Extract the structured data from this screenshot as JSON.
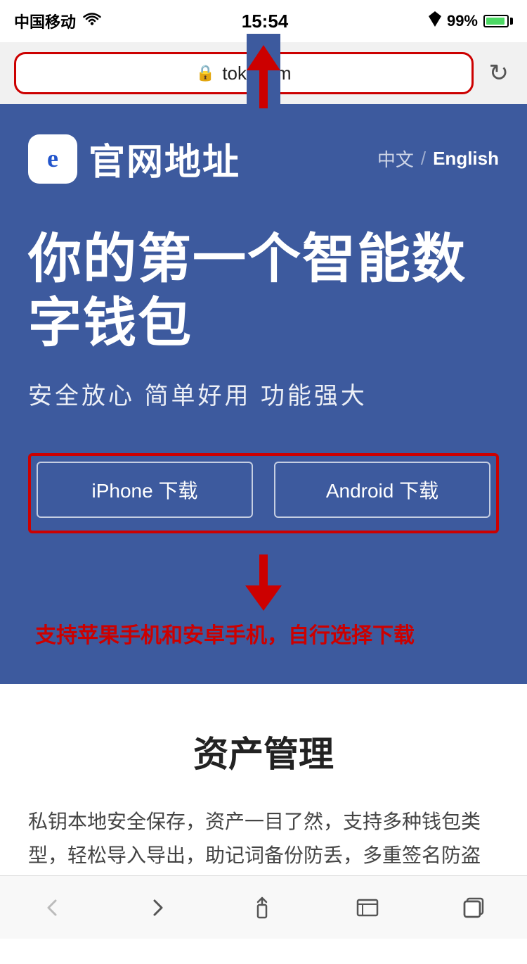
{
  "statusBar": {
    "carrier": "中国移动",
    "wifi": true,
    "time": "15:54",
    "location": true,
    "battery": "99%"
  },
  "browser": {
    "url": "token.im",
    "refresh_label": "↻"
  },
  "header": {
    "logo_char": "e",
    "title": "官网地址",
    "lang_zh": "中文",
    "lang_divider": "/",
    "lang_en": "English"
  },
  "hero": {
    "headline": "你的第一个智能数字钱包",
    "subheadline": "安全放心  简单好用  功能强大",
    "btn_iphone": "iPhone 下载",
    "btn_android": "Android 下载"
  },
  "annotation": {
    "text": "支持苹果手机和安卓手机，自行选择下载"
  },
  "section": {
    "title": "资产管理",
    "desc": "私钥本地安全保存，资产一目了然，支持多种钱包类型，轻松导入导出，助记词备份防丢，多重签名防盗"
  },
  "bottomNav": {
    "back": "‹",
    "forward": "›",
    "share": "↑",
    "bookmarks": "📖",
    "tabs": "⧉"
  }
}
